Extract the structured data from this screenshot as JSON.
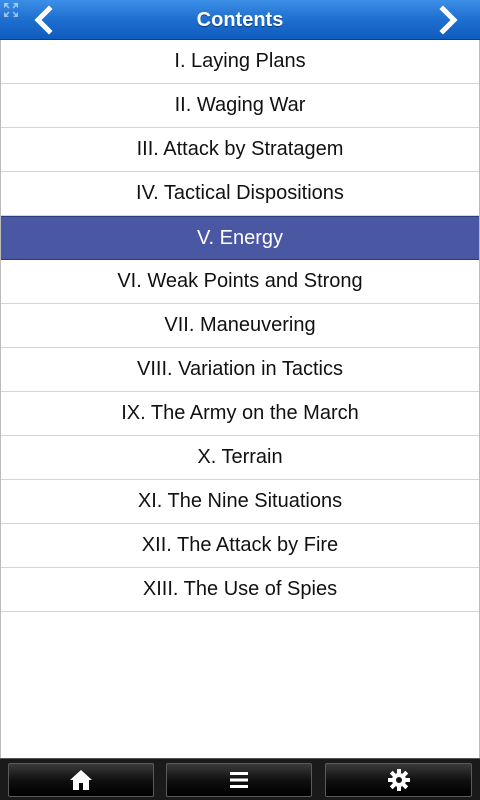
{
  "header": {
    "title": "Contents",
    "prev_icon": "chevron-left-icon",
    "next_icon": "chevron-right-icon"
  },
  "chapters": [
    {
      "label": "I. Laying Plans",
      "selected": false
    },
    {
      "label": "II. Waging War",
      "selected": false
    },
    {
      "label": "III. Attack by Stratagem",
      "selected": false
    },
    {
      "label": "IV. Tactical Dispositions",
      "selected": false
    },
    {
      "label": "V. Energy",
      "selected": true
    },
    {
      "label": "VI. Weak Points and Strong",
      "selected": false
    },
    {
      "label": "VII. Maneuvering",
      "selected": false
    },
    {
      "label": "VIII. Variation in Tactics",
      "selected": false
    },
    {
      "label": "IX. The Army on the March",
      "selected": false
    },
    {
      "label": "X. Terrain",
      "selected": false
    },
    {
      "label": "XI. The Nine Situations",
      "selected": false
    },
    {
      "label": "XII. The Attack by Fire",
      "selected": false
    },
    {
      "label": "XIII. The Use of Spies",
      "selected": false
    }
  ],
  "toolbar": {
    "items": [
      {
        "icon": "home-icon"
      },
      {
        "icon": "menu-icon"
      },
      {
        "icon": "gear-icon"
      }
    ]
  },
  "colors": {
    "header_blue": "#1e6fd0",
    "selected_row": "#4a57a3",
    "toolbar_black": "#000000"
  }
}
